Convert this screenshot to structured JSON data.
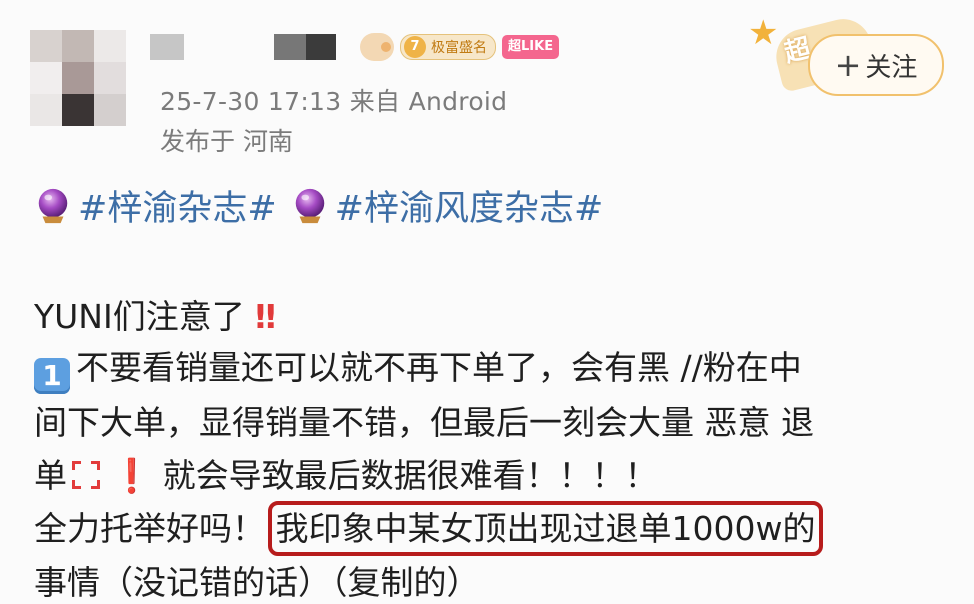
{
  "header": {
    "timestamp": "25-7-30 17:13",
    "source_prefix": "来自",
    "source": "Android",
    "location": "发布于 河南",
    "vip_level": "7",
    "vip_label": "极富盛名",
    "like_badge": "超LIKE",
    "super_label": "超",
    "follow_label": "关注",
    "follow_plus": "+"
  },
  "topics": [
    "#梓渝杂志#",
    "#梓渝风度杂志#"
  ],
  "post": {
    "line1_text": "YUNI们注意了",
    "line1_marks": "‼",
    "list_num": "1",
    "line2": "不要看销量还可以就不再下单了，会有黑 //粉在中",
    "line3": "间下大单，显得销量不错，但最后一刻会大量 恶意 退",
    "line4_a": "单",
    "line4_mark": "❗",
    "line4_b": "就会导致最后数据很难看！！！！",
    "line5_a": "全力托举好吗！",
    "line5_boxed": "我印象中某女顶出现过退单1000w的",
    "line6": "事情（没记错的话）（复制的）"
  },
  "colors": {
    "topic": "#3d6ea6",
    "highlight_box": "#b71c1c",
    "follow_border": "#f1c16d",
    "meta_text": "#7b7b7b"
  },
  "icons": [
    "crystal-ball-icon",
    "keycap-one-icon",
    "anger-symbol-icon",
    "double-exclamation-icon",
    "exclamation-icon",
    "star-icon",
    "bird-badge-icon"
  ]
}
